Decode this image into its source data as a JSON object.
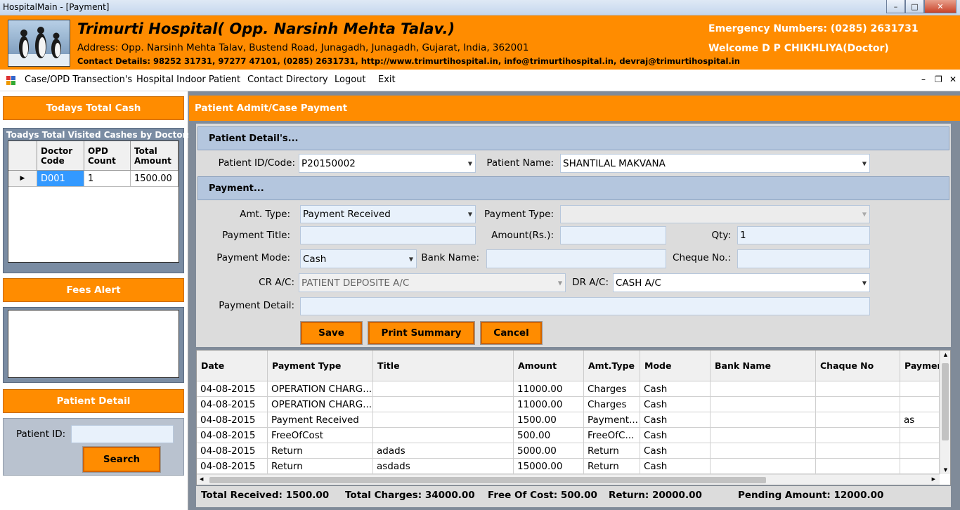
{
  "window": {
    "title": "HospitalMain - [Payment]"
  },
  "header": {
    "hospital_name": "Trimurti Hospital( Opp. Narsinh Mehta Talav.)",
    "address": "Address: Opp. Narsinh Mehta Talav, Bustend Road, Junagadh, Junagadh, Gujarat, India, 362001",
    "contact": "Contact Details: 98252 31731, 97277 47101, (0285) 2631731, http://www.trimurtihospital.in, info@trimurtihospital.in, devraj@trimurtihospital.in",
    "emergency": "Emergency Numbers: (0285) 2631731",
    "welcome": "Welcome D P CHIKHLIYA(Doctor)"
  },
  "menu": {
    "items": [
      "Case/OPD Transection's",
      "Hospital Indoor Patient",
      "Contact Directory",
      "Logout",
      "Exit"
    ]
  },
  "left": {
    "todays_cash_label": "Todays Total Cash",
    "visited_caption": "Toadys Total Visited Cashes by Doctors",
    "grid_headers": [
      "Doctor Code",
      "OPD Count",
      "Total Amount"
    ],
    "grid_rows": [
      [
        "D001",
        "1",
        "1500.00"
      ]
    ],
    "fees_alert_label": "Fees Alert",
    "patient_detail_label": "Patient Detail",
    "patient_id_label": "Patient ID:",
    "patient_id_value": "",
    "search_label": "Search"
  },
  "form": {
    "panel_title": "Patient Admit/Case Payment",
    "patient_section": "Patient Detail's...",
    "patient_id_label": "Patient ID/Code:",
    "patient_id_value": "P20150002",
    "patient_name_label": "Patient Name:",
    "patient_name_value": "SHANTILAL MAKVANA",
    "payment_section": "Payment...",
    "amt_type_label": "Amt. Type:",
    "amt_type_value": "Payment Received",
    "payment_type_label": "Payment Type:",
    "payment_type_value": "",
    "payment_title_label": "Payment Title:",
    "payment_title_value": "",
    "amount_label": "Amount(Rs.):",
    "amount_value": "",
    "qty_label": "Qty:",
    "qty_value": "1",
    "payment_mode_label": "Payment Mode:",
    "payment_mode_value": "Cash",
    "bank_name_label": "Bank Name:",
    "bank_name_value": "",
    "cheque_label": "Cheque No.:",
    "cheque_value": "",
    "cr_label": "CR A/C:",
    "cr_value": "PATIENT DEPOSITE A/C",
    "dr_label": "DR A/C:",
    "dr_value": "CASH A/C",
    "detail_label": "Payment Detail:",
    "detail_value": "",
    "save_label": "Save",
    "print_label": "Print Summary",
    "cancel_label": "Cancel"
  },
  "table": {
    "headers": [
      "Date",
      "Payment Type",
      "Title",
      "Amount",
      "Amt.Type",
      "Mode",
      "Bank Name",
      "Chaque No",
      "Payment"
    ],
    "rows": [
      [
        "04-08-2015",
        "OPERATION CHARG...",
        "",
        "11000.00",
        "Charges",
        "Cash",
        "",
        "",
        ""
      ],
      [
        "04-08-2015",
        "OPERATION CHARG...",
        "",
        "11000.00",
        "Charges",
        "Cash",
        "",
        "",
        ""
      ],
      [
        "04-08-2015",
        "Payment Received",
        "",
        "1500.00",
        "Payment...",
        "Cash",
        "",
        "",
        "as"
      ],
      [
        "04-08-2015",
        "FreeOfCost",
        "",
        "500.00",
        "FreeOfC...",
        "Cash",
        "",
        "",
        ""
      ],
      [
        "04-08-2015",
        "Return",
        "adads",
        "5000.00",
        "Return",
        "Cash",
        "",
        "",
        ""
      ],
      [
        "04-08-2015",
        "Return",
        "asdads",
        "15000.00",
        "Return",
        "Cash",
        "",
        "",
        ""
      ]
    ]
  },
  "summary": {
    "total_received": "Total Received: 1500.00",
    "total_charges": "Total Charges: 34000.00",
    "free_of_cost": "Free Of Cost: 500.00",
    "return": "Return: 20000.00",
    "pending": "Pending Amount: 12000.00"
  },
  "colors": {
    "accent": "#ff8c00",
    "section": "#b4c6de",
    "panel": "#808b99"
  }
}
